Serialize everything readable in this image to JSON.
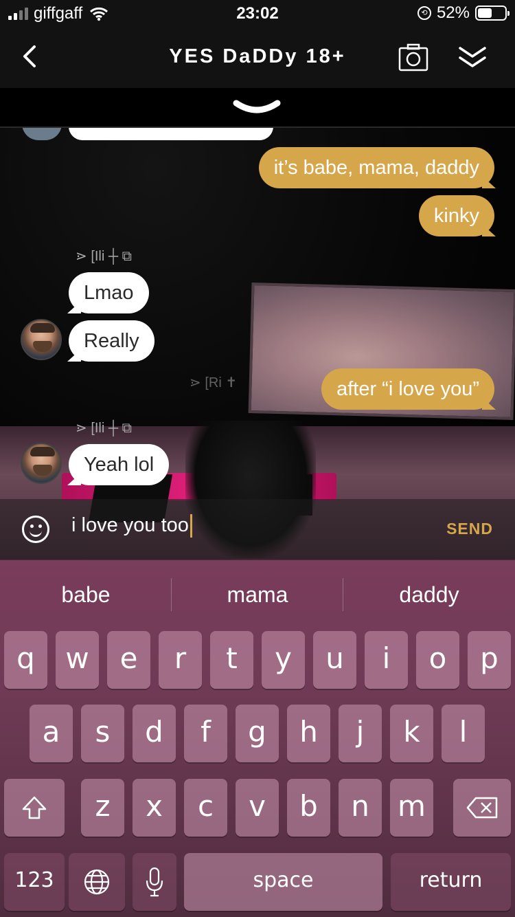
{
  "status_bar": {
    "carrier": "giffgaff",
    "time": "23:02",
    "battery_percent": "52%",
    "battery_level": 0.52
  },
  "nav": {
    "title": "YES DaDDy 18+",
    "back_icon": "chevron-left-icon",
    "camera_icon": "camera-icon",
    "collapse_icon": "double-chevron-down-icon",
    "pull_icon": "chevron-down-icon"
  },
  "messages": [
    {
      "side": "out",
      "text": "it’s babe, mama, daddy"
    },
    {
      "side": "out",
      "text": "kinky"
    },
    {
      "side": "in",
      "sender": "⋗ [Ili ┼ ⧉",
      "text": "Lmao"
    },
    {
      "side": "in",
      "text": "Really"
    },
    {
      "side": "out",
      "sender": "⋗ [Ri ✝",
      "text": "after “i love you”"
    },
    {
      "side": "in",
      "sender": "⋗ [Ili ┼ ⧉",
      "text": "Yeah lol"
    }
  ],
  "composer": {
    "value": "i love you too",
    "send_label": "SEND",
    "emoji_icon": "smiley-icon"
  },
  "keyboard": {
    "suggestions": [
      "babe",
      "mama",
      "daddy"
    ],
    "row1": [
      "q",
      "w",
      "e",
      "r",
      "t",
      "y",
      "u",
      "i",
      "o",
      "p"
    ],
    "row2": [
      "a",
      "s",
      "d",
      "f",
      "g",
      "h",
      "j",
      "k",
      "l"
    ],
    "row3": [
      "z",
      "x",
      "c",
      "v",
      "b",
      "n",
      "m"
    ],
    "numbers_label": "123",
    "space_label": "space",
    "return_label": "return",
    "shift_icon": "shift-icon",
    "delete_icon": "backspace-icon",
    "globe_icon": "globe-icon",
    "mic_icon": "microphone-icon"
  },
  "colors": {
    "accent": "#d6a64a",
    "keyboard_bg": "#6d3a54",
    "bar_bg": "#121212"
  }
}
